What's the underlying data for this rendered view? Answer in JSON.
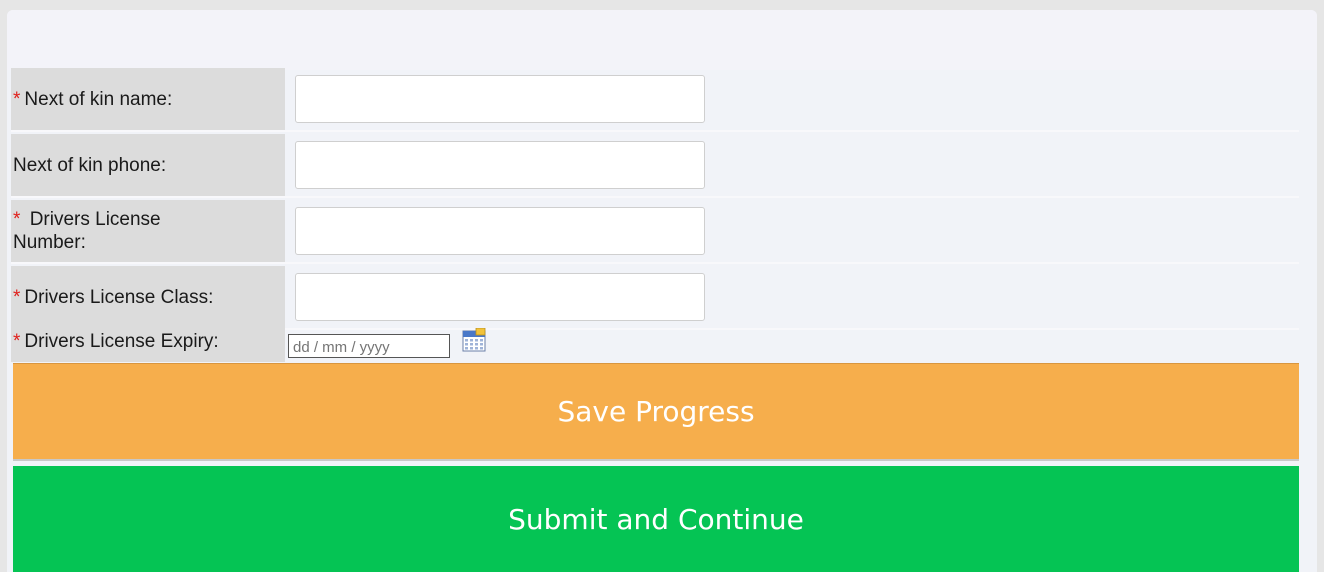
{
  "form": {
    "required_marker": "*",
    "fields": [
      {
        "label": "Next of kin name:",
        "required": true,
        "value": "",
        "placeholder": ""
      },
      {
        "label": "Next of kin phone:",
        "required": false,
        "value": "",
        "placeholder": ""
      },
      {
        "label": "Drivers License Number:",
        "required": true,
        "value": "",
        "placeholder": ""
      },
      {
        "label": "Drivers License Class:",
        "required": true,
        "value": "",
        "placeholder": ""
      }
    ],
    "expiry": {
      "label": "Drivers License Expiry:",
      "required": true,
      "placeholder": "dd / mm / yyyy",
      "icon": "calendar-icon"
    }
  },
  "actions": {
    "save_label": "Save Progress",
    "submit_label": "Submit and Continue"
  },
  "colors": {
    "save_button": "#f6ae4c",
    "submit_button": "#05c454",
    "required_marker": "#e0201c",
    "label_background": "#dcdcdc"
  }
}
